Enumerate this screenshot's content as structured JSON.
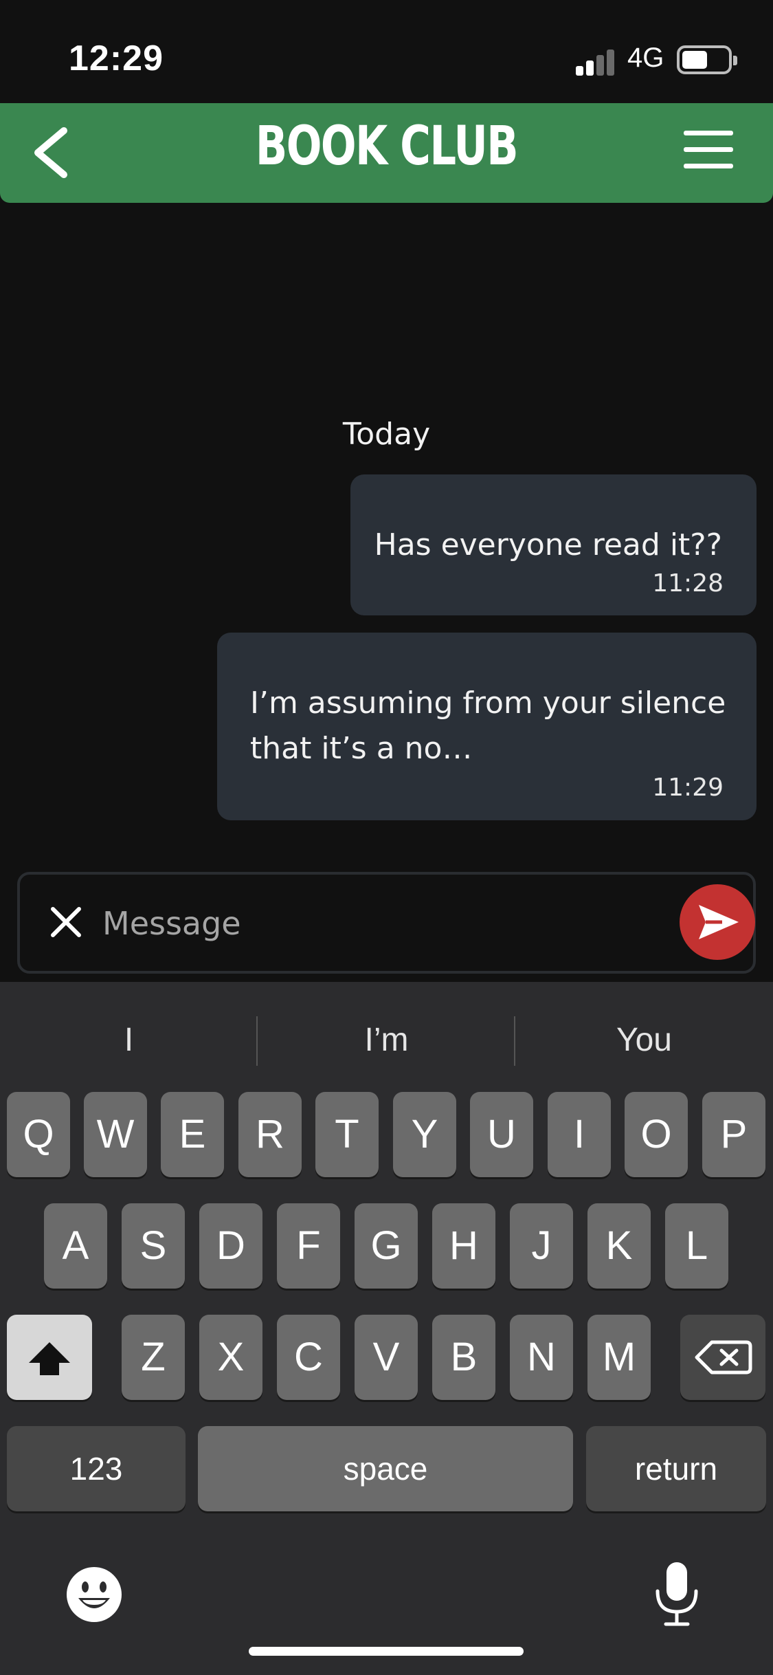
{
  "status_bar": {
    "time": "12:29",
    "network": "4G",
    "signal_bars_active": 2,
    "signal_bars_total": 4,
    "battery_level": 0.5
  },
  "header": {
    "title": "BOOK CLUB",
    "back_icon": "chevron-left-icon",
    "menu_icon": "hamburger-menu-icon",
    "color": "#3a8750"
  },
  "chat": {
    "day_label": "Today",
    "messages": [
      {
        "text": "Has everyone read it??",
        "time": "11:28"
      },
      {
        "text": "I’m assuming from your silence that it’s a no…",
        "time": "11:29"
      }
    ],
    "bubble_color": "#2a3038"
  },
  "composer": {
    "placeholder": "Message",
    "value": "",
    "clear_icon": "close-icon",
    "send_icon": "send-icon",
    "send_color": "#c33231"
  },
  "keyboard": {
    "suggestions": [
      "I",
      "I’m",
      "You"
    ],
    "row1": [
      "Q",
      "W",
      "E",
      "R",
      "T",
      "Y",
      "U",
      "I",
      "O",
      "P"
    ],
    "row2": [
      "A",
      "S",
      "D",
      "F",
      "G",
      "H",
      "J",
      "K",
      "L"
    ],
    "row3": [
      "Z",
      "X",
      "C",
      "V",
      "B",
      "N",
      "M"
    ],
    "numbers_label": "123",
    "space_label": "space",
    "return_label": "return",
    "shift_icon": "shift-icon",
    "delete_icon": "backspace-icon",
    "emoji_icon": "emoji-icon",
    "mic_icon": "microphone-icon"
  }
}
